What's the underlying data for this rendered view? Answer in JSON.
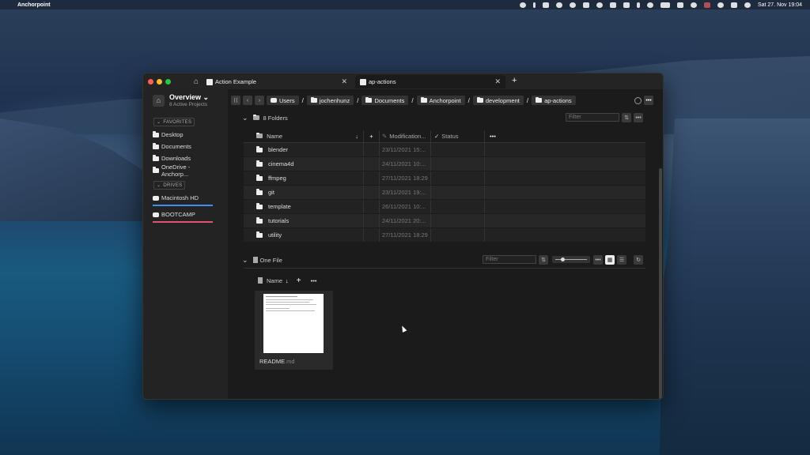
{
  "menubar": {
    "app_name": "Anchorpoint",
    "datetime": "Sat 27. Nov  19:04"
  },
  "tabs": [
    {
      "label": "Action Example"
    },
    {
      "label": "ap-actions"
    }
  ],
  "sidebar": {
    "overview_title": "Overview",
    "overview_sub": "8 Active Projects",
    "favorites_label": "FAVORITES",
    "favorites": [
      "Desktop",
      "Documents",
      "Downloads",
      "OneDrive - Anchorp..."
    ],
    "drives_label": "DRIVES",
    "drives": [
      {
        "label": "Macintosh HD",
        "color": "#3f8ef0"
      },
      {
        "label": "BOOTCAMP",
        "color": "#e0536a"
      }
    ]
  },
  "breadcrumb": [
    "Users",
    "jochenhunz",
    "Documents",
    "Anchorpoint",
    "development",
    "ap-actions"
  ],
  "folders": {
    "title": "8 Folders",
    "filter_placeholder": "Filter",
    "columns": {
      "name": "Name",
      "modification": "Modification...",
      "status": "Status"
    },
    "rows": [
      {
        "name": "blender",
        "date": "23/11/2021 15:..."
      },
      {
        "name": "cinema4d",
        "date": "24/11/2021 10:..."
      },
      {
        "name": "ffmpeg",
        "date": "27/11/2021 18:29"
      },
      {
        "name": "git",
        "date": "23/11/2021 19:..."
      },
      {
        "name": "template",
        "date": "26/11/2021 10:..."
      },
      {
        "name": "tutorials",
        "date": "24/11/2021 20:..."
      },
      {
        "name": "utility",
        "date": "27/11/2021 18:29"
      }
    ]
  },
  "files": {
    "title": "One File",
    "filter_placeholder": "Filter",
    "name_col": "Name",
    "items": [
      {
        "name": "README",
        "ext": ".md"
      }
    ]
  }
}
